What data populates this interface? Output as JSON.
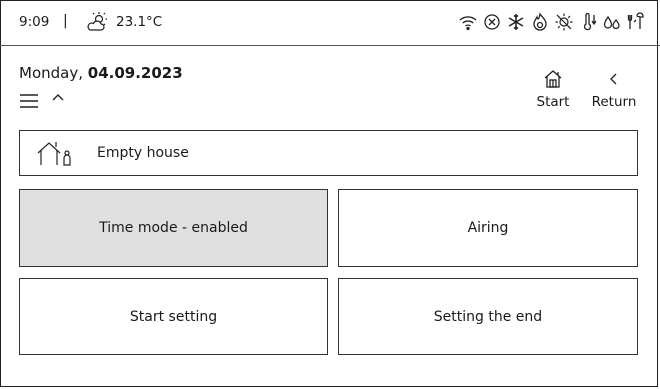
{
  "status_bar": {
    "time": "9:09",
    "separator": "|",
    "weather_icon": "partly-sunny-icon",
    "temperature": "23.1°C",
    "icons": [
      "wifi-icon",
      "no-connection-icon",
      "snowflake-icon",
      "flame-icon",
      "sun-off-icon",
      "temperature-down-icon",
      "water-drops-icon",
      "tool-icon"
    ]
  },
  "header": {
    "date_prefix": "Monday, ",
    "date_value": "04.09.2023",
    "menu_icon": "hamburger-menu-icon",
    "caret_icon": "chevron-up-icon"
  },
  "nav": {
    "start_label": "Start",
    "start_icon": "home-icon",
    "return_label": "Return",
    "return_icon": "chevron-left-icon"
  },
  "mode": {
    "label": "Empty house",
    "icon": "empty-house-icon"
  },
  "tiles": [
    {
      "label": "Time mode - enabled",
      "active": true
    },
    {
      "label": "Airing",
      "active": false
    },
    {
      "label": "Start setting",
      "active": false
    },
    {
      "label": "Setting the end",
      "active": false
    }
  ]
}
